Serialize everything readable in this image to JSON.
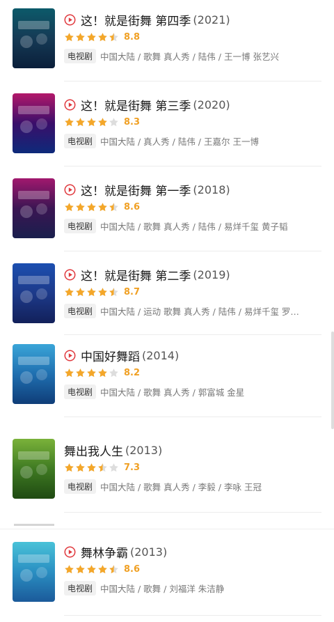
{
  "colors": {
    "accent": "#e0393e",
    "star": "#f4a72a",
    "star_off": "#dddddd"
  },
  "items": [
    {
      "title": "这！就是街舞 第四季",
      "year": "(2021)",
      "playable": true,
      "score": "8.8",
      "stars": 4.5,
      "tag": "电视剧",
      "meta": "中国大陆 / 歌舞 真人秀 / 陆伟 / 王一博 张艺兴",
      "poster_colors": [
        "#0c5a6a",
        "#153a55",
        "#0a1f3a"
      ]
    },
    {
      "title": "这！就是街舞 第三季",
      "year": "(2020)",
      "playable": true,
      "score": "8.3",
      "stars": 4,
      "tag": "电视剧",
      "meta": "中国大陆 / 真人秀 / 陆伟 / 王嘉尔 王一博",
      "poster_colors": [
        "#b3186a",
        "#3a0e6a",
        "#0d2a7a"
      ]
    },
    {
      "title": "这！就是街舞 第一季",
      "year": "(2018)",
      "playable": true,
      "score": "8.6",
      "stars": 4.5,
      "tag": "电视剧",
      "meta": "中国大陆 / 歌舞 真人秀 / 陆伟 / 易烊千玺 黄子韬",
      "poster_colors": [
        "#a1186e",
        "#3b1553",
        "#1a1f4d"
      ]
    },
    {
      "title": "这！就是街舞 第二季",
      "year": "(2019)",
      "playable": true,
      "score": "8.7",
      "stars": 4.5,
      "tag": "电视剧",
      "meta": "中国大陆 / 运动 歌舞 真人秀 / 陆伟 / 易烊千玺 罗…",
      "poster_colors": [
        "#1c4fb0",
        "#1d3a8a",
        "#12205a"
      ]
    },
    {
      "title": "中国好舞蹈",
      "year": "(2014)",
      "playable": true,
      "score": "8.2",
      "stars": 4,
      "tag": "电视剧",
      "meta": "中国大陆 / 歌舞 真人秀 / 郭富城 金星",
      "poster_colors": [
        "#3aa5d8",
        "#1f6fb0",
        "#0f3d78"
      ]
    },
    {
      "title": "舞出我人生",
      "year": "(2013)",
      "playable": false,
      "score": "7.3",
      "stars": 3.5,
      "tag": "电视剧",
      "meta": "中国大陆 / 歌舞 真人秀 / 李毅 / 李咏 王冠",
      "poster_colors": [
        "#7ab23a",
        "#3f7a22",
        "#1f4a12"
      ]
    },
    {
      "title": "舞林争霸",
      "year": "(2013)",
      "playable": true,
      "score": "8.6",
      "stars": 4.5,
      "tag": "电视剧",
      "meta": "中国大陆 / 歌舞 / 刘福洋 朱洁静",
      "poster_colors": [
        "#49c2d8",
        "#2a8fc2",
        "#1b5a9a"
      ]
    }
  ]
}
